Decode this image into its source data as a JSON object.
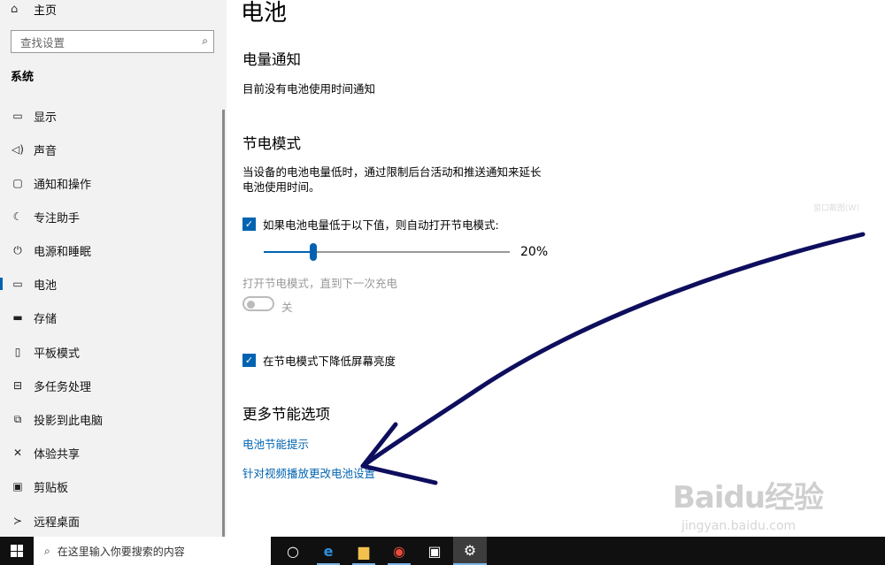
{
  "sidebar": {
    "home_label": "主页",
    "search_placeholder": "查找设置",
    "section_title": "系统",
    "items": [
      {
        "label": "显示",
        "icon": "monitor-icon"
      },
      {
        "label": "声音",
        "icon": "speaker-icon"
      },
      {
        "label": "通知和操作",
        "icon": "message-icon"
      },
      {
        "label": "专注助手",
        "icon": "moon-icon"
      },
      {
        "label": "电源和睡眠",
        "icon": "power-icon"
      },
      {
        "label": "电池",
        "icon": "battery-icon",
        "active": true
      },
      {
        "label": "存储",
        "icon": "storage-icon"
      },
      {
        "label": "平板模式",
        "icon": "tablet-icon"
      },
      {
        "label": "多任务处理",
        "icon": "multitask-icon"
      },
      {
        "label": "投影到此电脑",
        "icon": "project-icon"
      },
      {
        "label": "体验共享",
        "icon": "share-icon"
      },
      {
        "label": "剪贴板",
        "icon": "clipboard-icon"
      },
      {
        "label": "远程桌面",
        "icon": "remote-icon"
      }
    ]
  },
  "main": {
    "page_title": "电池",
    "notify_heading": "电量通知",
    "notify_text": "目前没有电池使用时间通知",
    "saver_heading": "节电模式",
    "saver_desc_line1": "当设备的电池电量低时，通过限制后台活动和推送通知来延长",
    "saver_desc_line2": "电池使用时间。",
    "auto_saver_label": "如果电池电量低于以下值，则自动打开节电模式:",
    "threshold_value": 20,
    "threshold_text": "20%",
    "open_saver_label": "打开节电模式，直到下一次充电",
    "toggle_state": "关",
    "lower_brightness_label": "在节电模式下降低屏幕亮度",
    "more_heading": "更多节能选项",
    "link_tips": "电池节能提示",
    "link_video": "针对视频播放更改电池设置",
    "ghost_button": "窗口截图(W)"
  },
  "taskbar": {
    "search_placeholder": "在这里输入你要搜索的内容",
    "icons": [
      "cortana-icon",
      "edge-icon",
      "explorer-icon",
      "chrome-icon",
      "store-icon",
      "settings-icon"
    ]
  },
  "watermark": {
    "logo": "Baidu经验",
    "url": "jingyan.baidu.com"
  },
  "colors": {
    "accent": "#0063b1",
    "arrow": "#0e0e5e",
    "sidebar_bg": "#f2f2f2",
    "taskbar_bg": "#101010"
  }
}
